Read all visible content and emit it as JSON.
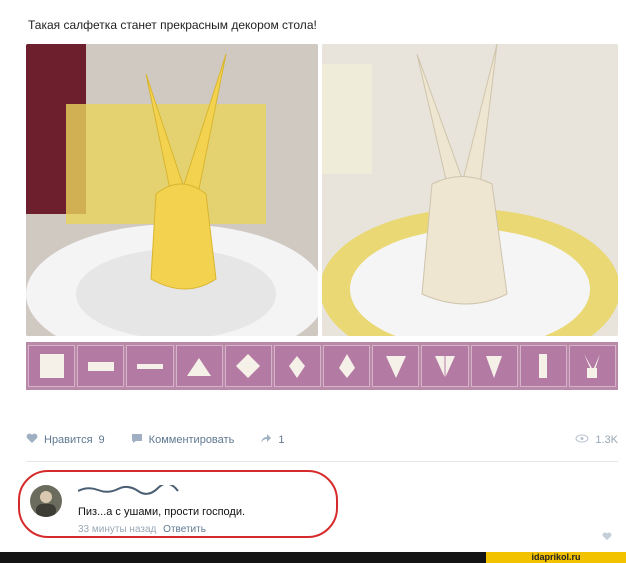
{
  "post": {
    "text": "Такая салфетка станет прекрасным декором стола!"
  },
  "photos": {
    "left_icon": "bunny-napkin-yellow",
    "right_icon": "bunny-napkin-cream"
  },
  "steps": {
    "count": 12
  },
  "actions": {
    "like_label": "Нравится",
    "like_count": "9",
    "comment_label": "Комментировать",
    "share_count": "1",
    "views_count": "1.3K"
  },
  "comment": {
    "text": "Пиз...а с ушами, прости господи.",
    "time": "33 минуты назад",
    "reply_label": "Ответить"
  },
  "watermark": {
    "text": "idaprikol.ru"
  },
  "colors": {
    "accent": "#5f7892",
    "highlight_ring": "#d62b2b",
    "steps_bg": "#b88aa8",
    "napkin_yellow": "#f2d24e",
    "napkin_cream": "#efe6d2"
  }
}
